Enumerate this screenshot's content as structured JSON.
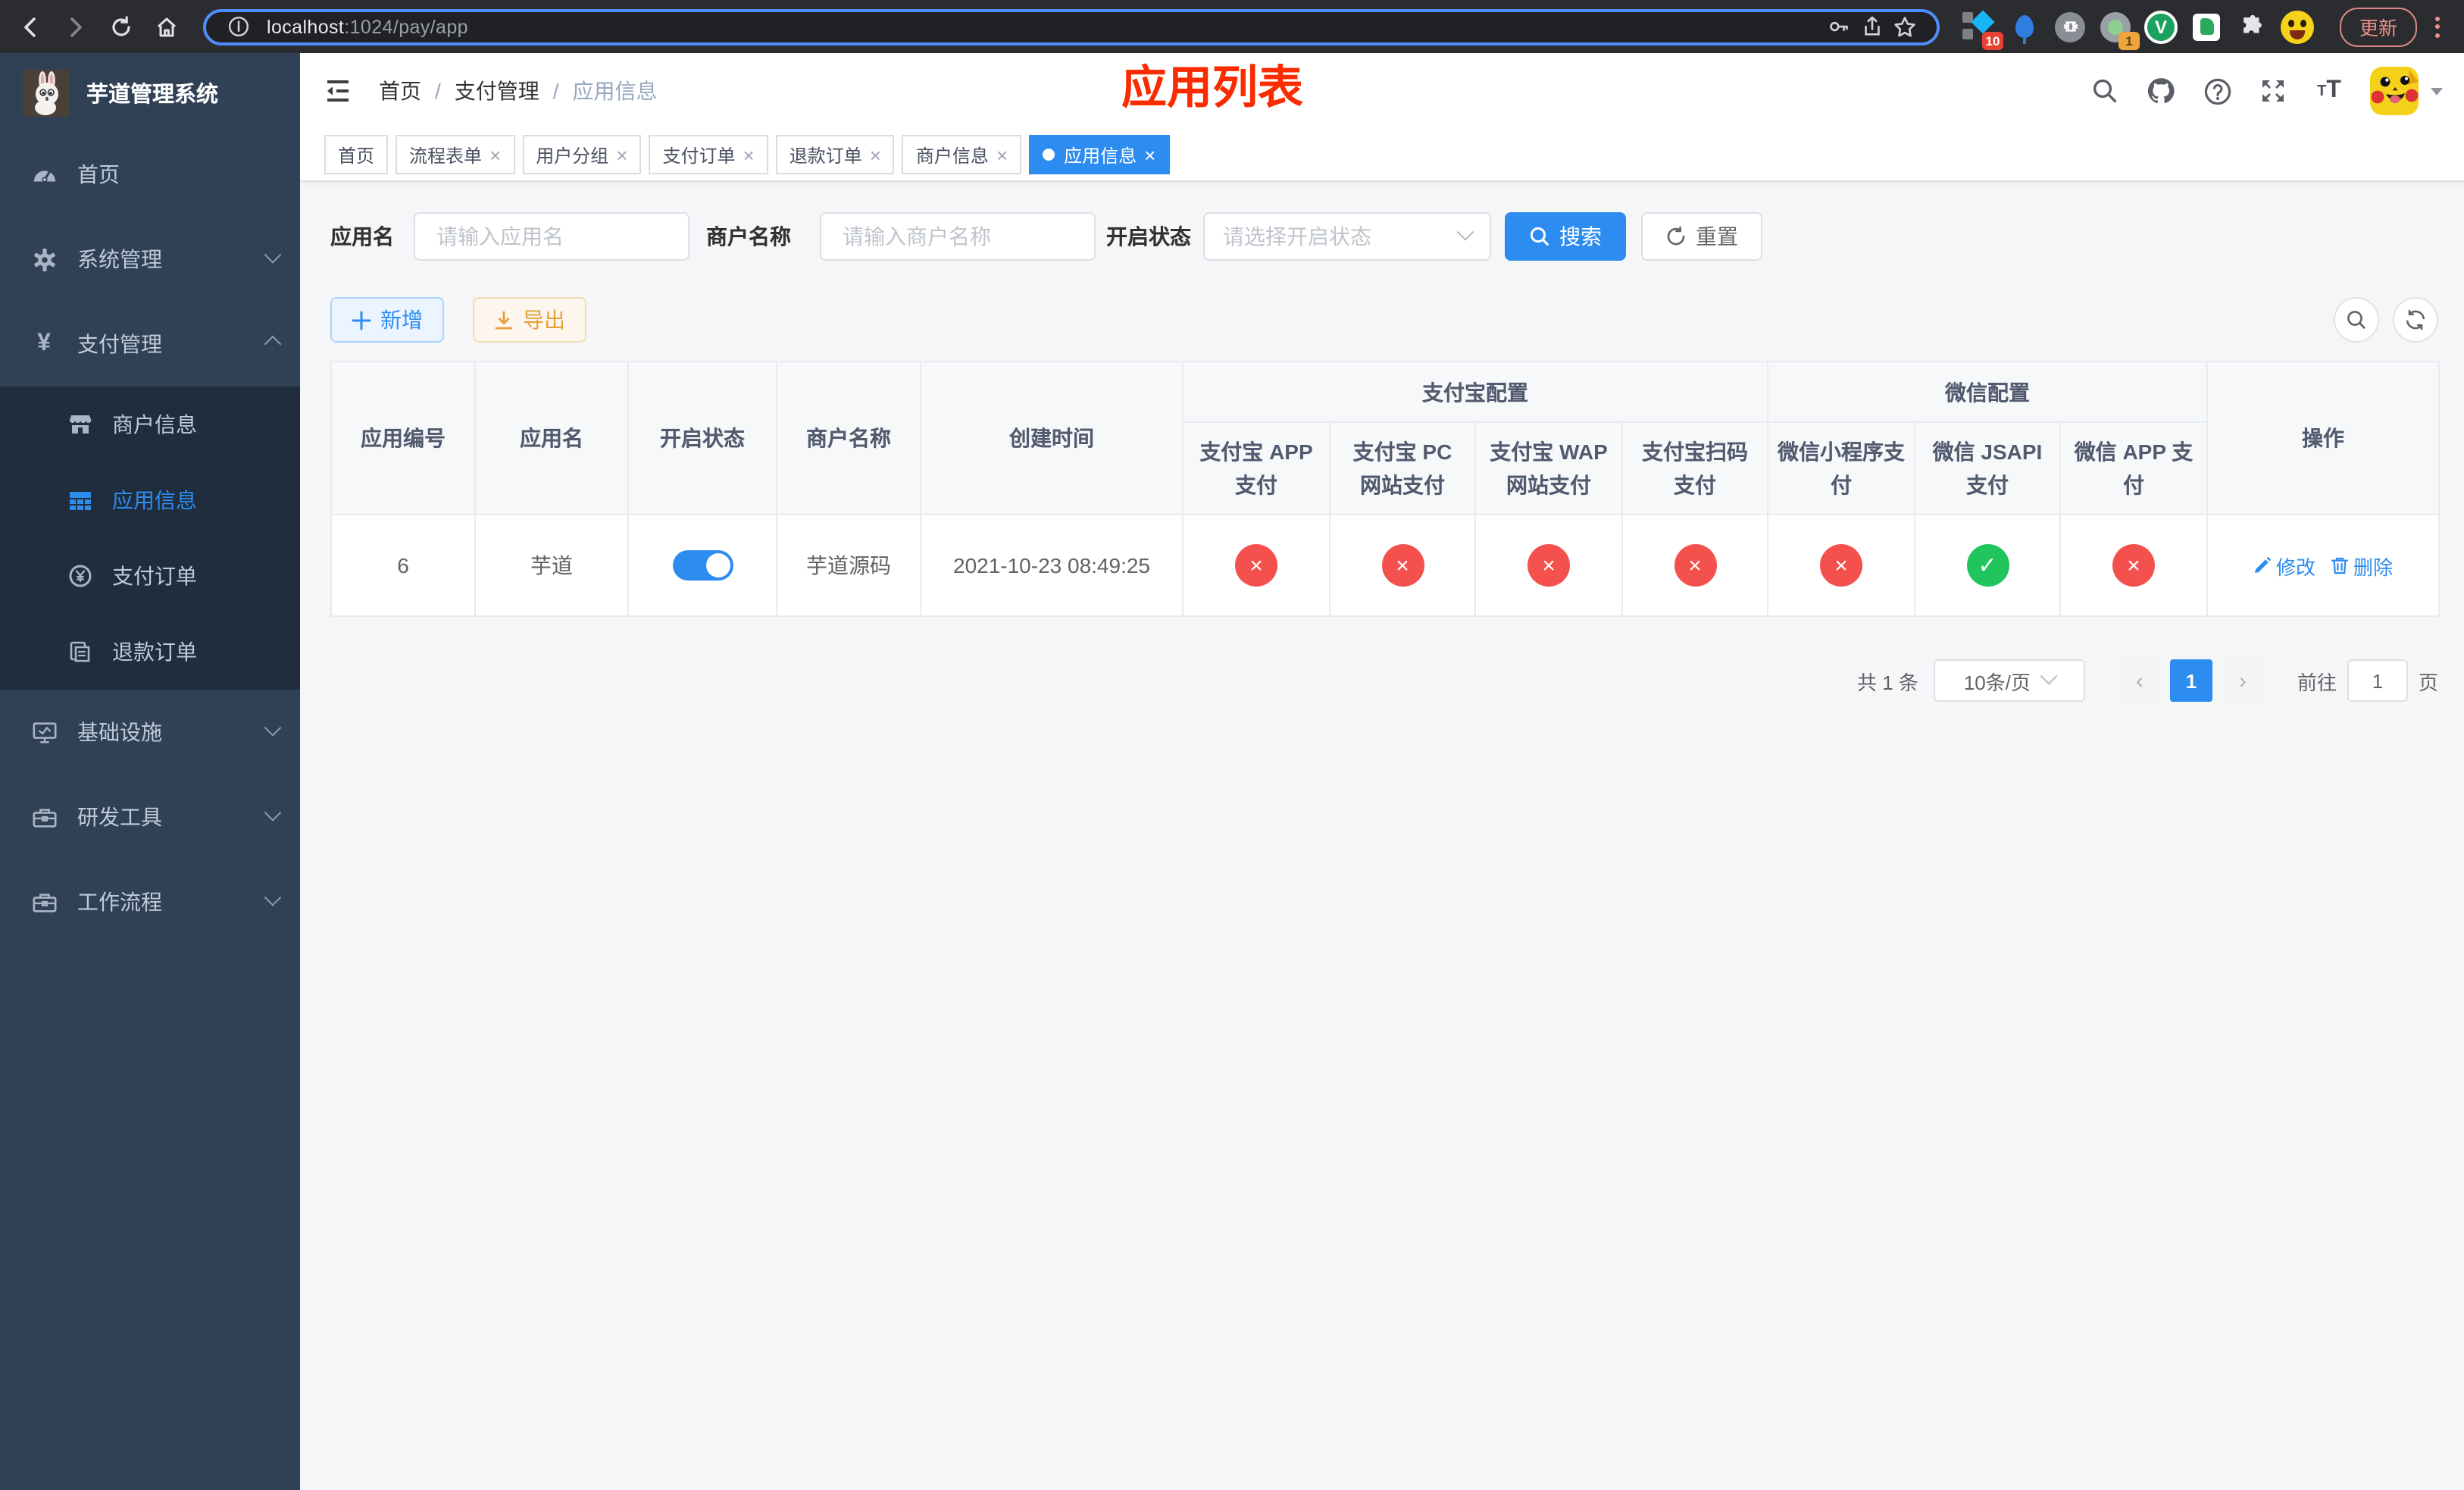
{
  "colors": {
    "accent_blue": "#2d8cf0",
    "sidebar_bg": "#304156",
    "submenu_bg": "#1f2d3d",
    "overlay_red": "#fb2b00",
    "status_red": "#f4504d",
    "status_green": "#21c55e",
    "export_orange": "#e6a23c",
    "update_red": "#f0928c"
  },
  "browser": {
    "url_host": "localhost",
    "url_rest": ":1024/pay/app",
    "update_label": "更新",
    "ext_badge_pinned": "10",
    "ext_badge_recorder": "1",
    "ext_v_label": "V"
  },
  "sidebar": {
    "app_title": "芋道管理系统",
    "items": {
      "home": "首页",
      "system": "系统管理",
      "payment": "支付管理",
      "merchant": "商户信息",
      "app_info": "应用信息",
      "pay_order": "支付订单",
      "refund_order": "退款订单",
      "infra": "基础设施",
      "dev_tools": "研发工具",
      "workflow": "工作流程"
    }
  },
  "header": {
    "breadcrumb": {
      "home": "首页",
      "parent": "支付管理",
      "current": "应用信息",
      "sep": "/"
    },
    "overlay_title": "应用列表"
  },
  "tabs": [
    {
      "label": "首页",
      "closable": false
    },
    {
      "label": "流程表单",
      "closable": true
    },
    {
      "label": "用户分组",
      "closable": true
    },
    {
      "label": "支付订单",
      "closable": true
    },
    {
      "label": "退款订单",
      "closable": true
    },
    {
      "label": "商户信息",
      "closable": true
    },
    {
      "label": "应用信息",
      "closable": true,
      "active": true
    }
  ],
  "icons": {
    "close": "×",
    "yen": "¥",
    "prev": "‹",
    "next": "›"
  },
  "filters": {
    "app_name_label": "应用名",
    "app_name_placeholder": "请输入应用名",
    "merchant_label": "商户名称",
    "merchant_placeholder": "请输入商户名称",
    "status_label": "开启状态",
    "status_placeholder": "请选择开启状态",
    "search_label": "搜索",
    "reset_label": "重置"
  },
  "toolbar": {
    "add_label": "新增",
    "export_label": "导出"
  },
  "table": {
    "col_app_id": "应用编号",
    "col_app_name": "应用名",
    "col_status": "开启状态",
    "col_merchant": "商户名称",
    "col_created": "创建时间",
    "group_alipay": "支付宝配置",
    "group_wechat": "微信配置",
    "col_alipay_app": "支付宝 APP 支付",
    "col_alipay_pc": "支付宝 PC 网站支付",
    "col_alipay_wap": "支付宝 WAP 网站支付",
    "col_alipay_qr": "支付宝扫码支付",
    "col_wx_mini": "微信小程序支付",
    "col_wx_jsapi": "微信 JSAPI 支付",
    "col_wx_app": "微信 APP 支付",
    "col_actions": "操作",
    "row": {
      "app_id": "6",
      "app_name": "芋道",
      "status_on": true,
      "merchant": "芋道源码",
      "created": "2021-10-23 08:49:25",
      "channels": [
        {
          "name": "支付宝 APP 支付",
          "enabled": false,
          "glyph": "×"
        },
        {
          "name": "支付宝 PC 网站支付",
          "enabled": false,
          "glyph": "×"
        },
        {
          "name": "支付宝 WAP 网站支付",
          "enabled": false,
          "glyph": "×"
        },
        {
          "name": "支付宝扫码支付",
          "enabled": false,
          "glyph": "×"
        },
        {
          "name": "微信小程序支付",
          "enabled": false,
          "glyph": "×"
        },
        {
          "name": "微信 JSAPI 支付",
          "enabled": true,
          "glyph": "✓"
        },
        {
          "name": "微信 APP 支付",
          "enabled": false,
          "glyph": "×"
        }
      ],
      "edit_label": "修改",
      "delete_label": "删除"
    }
  },
  "pagination": {
    "total": "共 1 条",
    "page_size": "10条/页",
    "page": "1",
    "goto_label": "前往",
    "goto_value": "1",
    "goto_unit": "页"
  }
}
